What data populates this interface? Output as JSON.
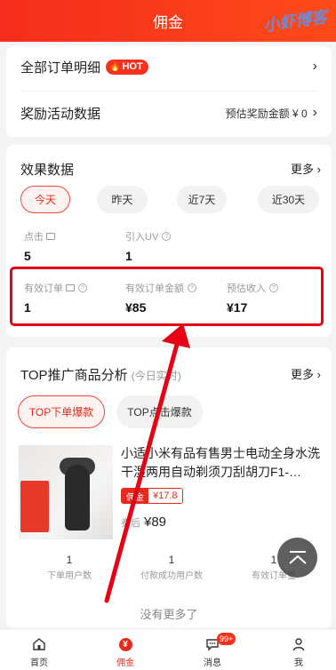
{
  "header": {
    "title": "佣金",
    "watermark": "小虾博客"
  },
  "summary": {
    "orders_label": "全部订单明细",
    "hot_badge": "HOT",
    "activity_label": "奖励活动数据",
    "activity_value": "预估奖励金额 ¥ 0"
  },
  "effect": {
    "title": "效果数据",
    "more": "更多",
    "ranges": [
      "今天",
      "昨天",
      "近7天",
      "近30天"
    ],
    "active_range": "今天",
    "clicks_label": "点击",
    "clicks_value": "5",
    "uv_label": "引入UV",
    "uv_value": "1",
    "valid_orders_label": "有效订单",
    "valid_orders_value": "1",
    "valid_amount_label": "有效订单金额",
    "valid_amount_value": "¥85",
    "est_income_label": "预估收入",
    "est_income_value": "¥17"
  },
  "top": {
    "title": "TOP推广商品分析",
    "subtitle": "(今日实时)",
    "more": "更多",
    "tab_active": "TOP下单爆款",
    "tab_other": "TOP点击爆款",
    "product": {
      "title": "小适小米有品有售男士电动全身水洗干湿两用自动剃须刀刮胡刀F1-…",
      "commission_label": "佣金",
      "commission_value": "¥17.8",
      "price_label": "券后",
      "price_value": "¥89"
    },
    "stats": [
      {
        "value": "1",
        "label": "下单用户数"
      },
      {
        "value": "1",
        "label": "付款成功用户数"
      },
      {
        "value": "1",
        "label": "有效订单量"
      }
    ],
    "no_more": "没有更多了"
  },
  "tabbar": {
    "items": [
      {
        "label": "首页",
        "icon": "home-icon"
      },
      {
        "label": "佣金",
        "icon": "yen-icon"
      },
      {
        "label": "消息",
        "icon": "message-icon",
        "badge": "99+"
      },
      {
        "label": "我",
        "icon": "person-icon"
      }
    ],
    "active": "佣金"
  },
  "colors": {
    "brand": "#f52d1c",
    "highlight_box": "#e50015",
    "annotation_arrow": "#e50015"
  }
}
